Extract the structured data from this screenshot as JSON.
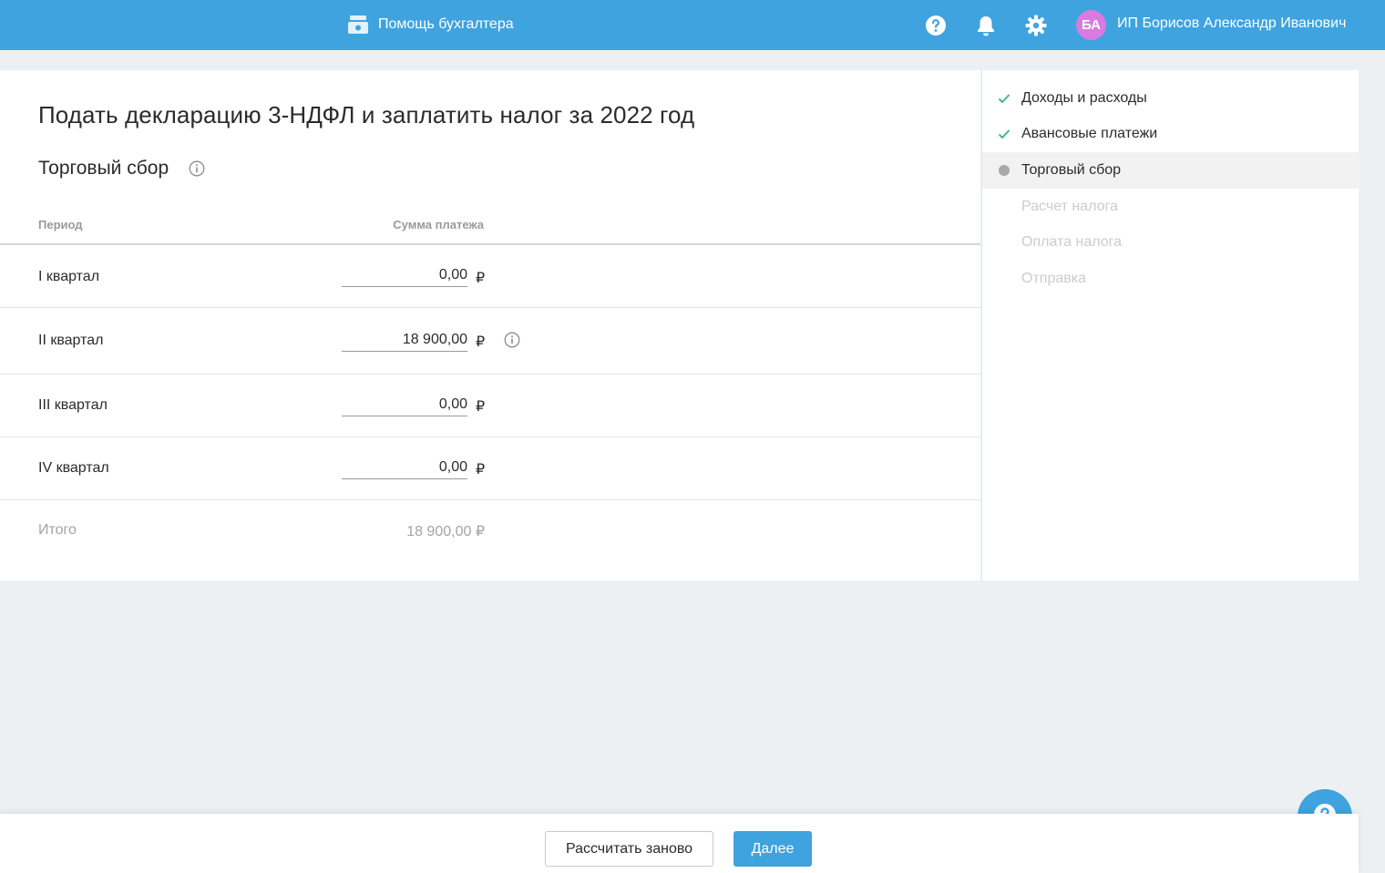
{
  "header": {
    "helper_label": "Помощь бухгалтера",
    "help_icon": "question-circle-icon",
    "notifications_icon": "bell-icon",
    "settings_icon": "gear-icon",
    "avatar_initials": "БА",
    "avatar_color": "#d97be0",
    "user_name": "ИП Борисов Александр Иванович",
    "brand_color": "#3fa3df"
  },
  "main": {
    "title": "Подать декларацию 3-НДФЛ и заплатить налог за 2022 год",
    "section_title": "Торговый сбор",
    "table": {
      "col_period": "Период",
      "col_sum": "Сумма платежа",
      "currency": "₽",
      "rows": [
        {
          "period": "I квартал",
          "amount": "0,00"
        },
        {
          "period": "II квартал",
          "amount": "18 900,00"
        },
        {
          "period": "III квартал",
          "amount": "0,00"
        },
        {
          "period": "IV квартал",
          "amount": "0,00"
        }
      ],
      "total_label": "Итого",
      "total_value": "18 900,00 ₽"
    }
  },
  "steps": [
    {
      "label": "Доходы и расходы",
      "status": "done"
    },
    {
      "label": "Авансовые платежи",
      "status": "done"
    },
    {
      "label": "Торговый сбор",
      "status": "active"
    },
    {
      "label": "Расчет налога",
      "status": "todo"
    },
    {
      "label": "Оплата налога",
      "status": "todo"
    },
    {
      "label": "Отправка",
      "status": "todo"
    }
  ],
  "footer": {
    "recalc_label": "Рассчитать заново",
    "next_label": "Далее"
  }
}
